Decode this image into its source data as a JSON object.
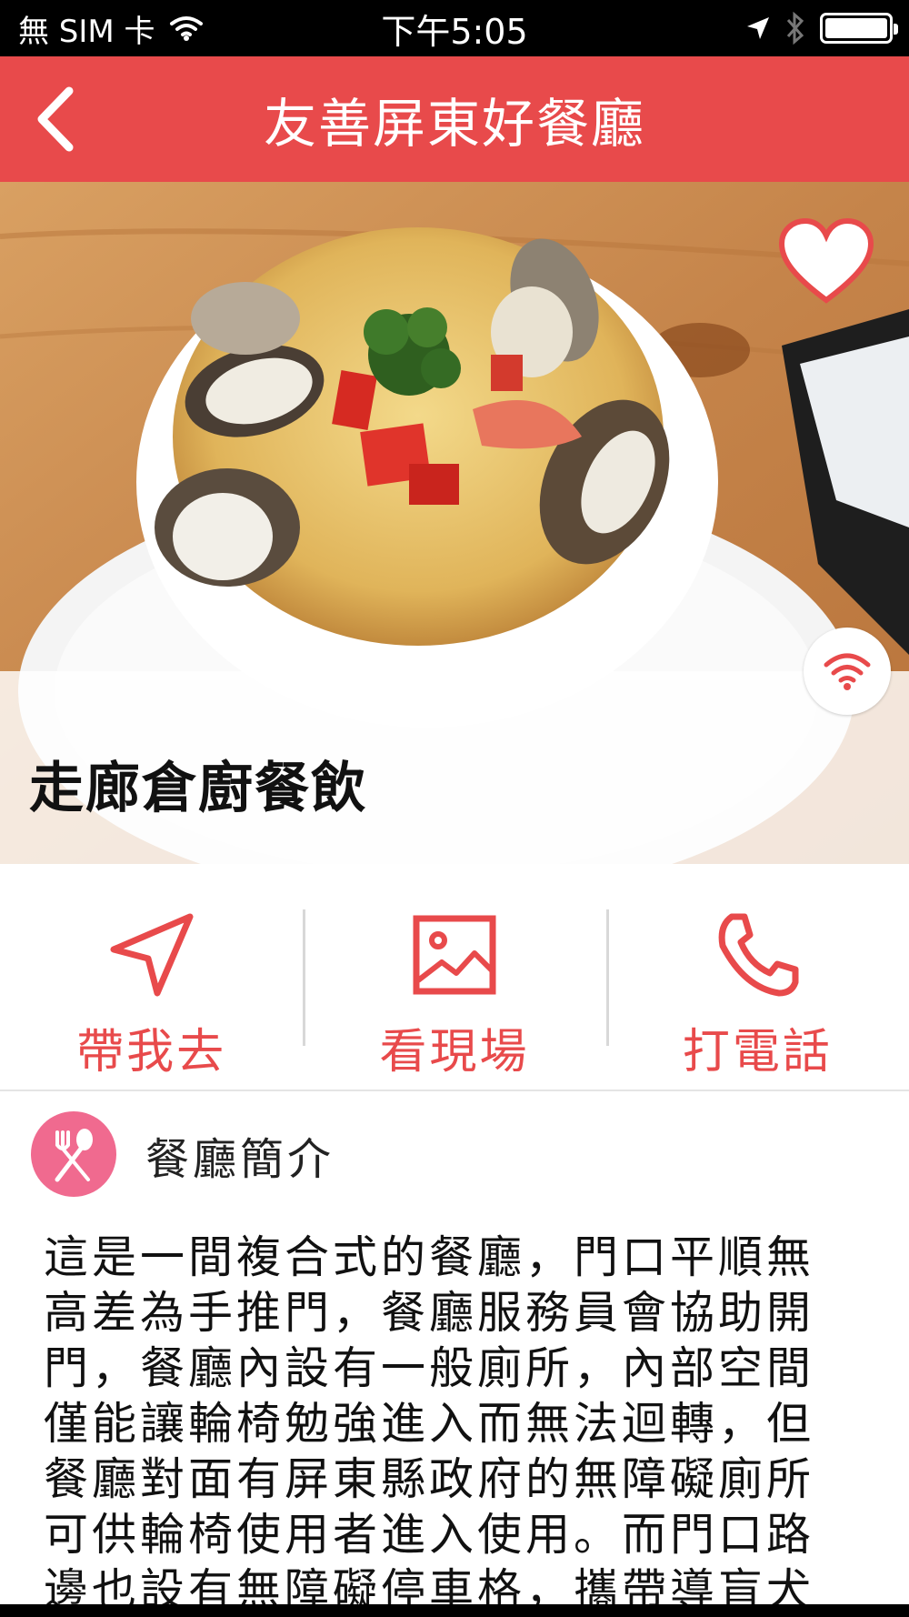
{
  "status_bar": {
    "carrier": "無 SIM 卡",
    "time": "下午5:05",
    "icons": [
      "wifi-icon",
      "location-arrow-icon",
      "bluetooth-icon",
      "battery-icon"
    ]
  },
  "nav": {
    "title": "友善屏東好餐廳",
    "back_icon": "chevron-left-icon"
  },
  "hero": {
    "favorite_icon": "heart-icon",
    "badge_icon": "wifi-icon",
    "restaurant_name": "走廊倉廚餐飲"
  },
  "actions": [
    {
      "label": "帶我去",
      "icon": "navigation-arrow-icon"
    },
    {
      "label": "看現場",
      "icon": "image-icon"
    },
    {
      "label": "打電話",
      "icon": "phone-icon"
    }
  ],
  "intro": {
    "icon": "fork-spoon-icon",
    "title": "餐廳簡介",
    "lines": [
      "這是一間複合式的餐廳，門口平順無",
      "高差為手推門，餐廳服務員會協助開",
      "門，餐廳內設有一般廁所，內部空間",
      "僅能讓輪椅勉強進入而無法迴轉，但",
      "餐廳對面有屏東縣政府的無障礙廁所",
      "可供輪椅使用者進入使用。而門口路",
      "邊也設有無障礙停車格，攜帶導盲犬"
    ]
  },
  "colors": {
    "accent": "#e84a4b",
    "intro_icon_bg": "#f06a8f"
  }
}
